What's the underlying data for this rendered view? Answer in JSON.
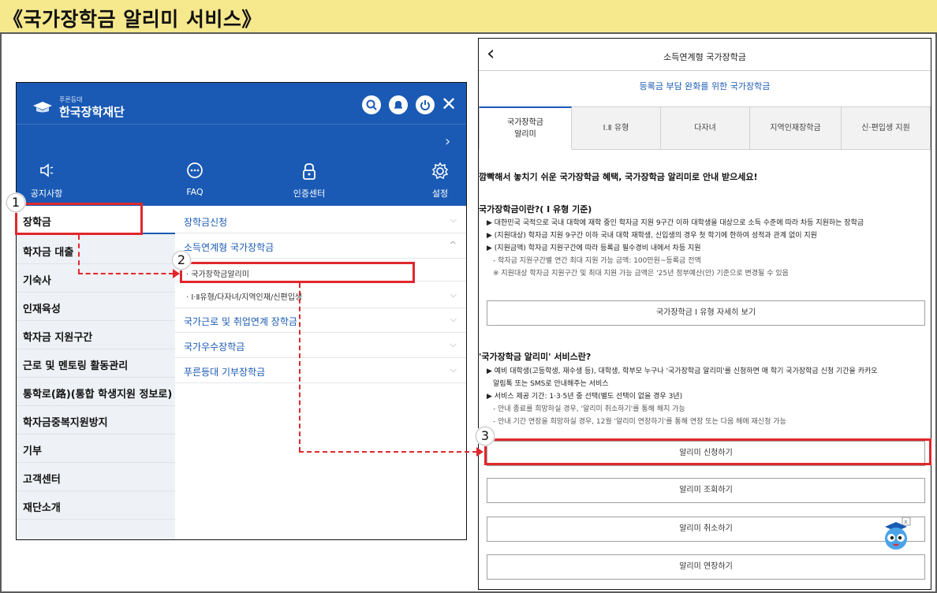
{
  "page_title": "《국가장학금 알리미 서비스》",
  "left_app": {
    "logo_sub": "푸른등대",
    "logo_name": "한국장학재단",
    "top_icons": [
      "search-icon",
      "bell-icon",
      "power-icon",
      "close-icon"
    ],
    "quick_menu": [
      {
        "label": "공지사항",
        "icon": "speaker-icon"
      },
      {
        "label": "FAQ",
        "icon": "chat-icon"
      },
      {
        "label": "인증센터",
        "icon": "lock-icon"
      },
      {
        "label": "설정",
        "icon": "gear-icon"
      }
    ],
    "menu": [
      "장학금",
      "학자금 대출",
      "기숙사",
      "인재육성",
      "학자금 지원구간",
      "근로 및 멘토링 활동관리",
      "통학로(路)(통합 학생지원 정보로)",
      "학자금중복지원방지",
      "기부",
      "고객센터",
      "재단소개"
    ],
    "submenu": [
      {
        "label": "장학금신청",
        "child": false
      },
      {
        "label": "소득연계형 국가장학금",
        "child": false
      },
      {
        "label": "· 국가장학금알리미",
        "child": true
      },
      {
        "label": "· Ⅰ·Ⅱ유형/다자녀/지역인재/신편입생",
        "child": true
      },
      {
        "label": "국가근로 및 취업연계 장학금",
        "child": false
      },
      {
        "label": "국가우수장학금",
        "child": false
      },
      {
        "label": "푸른등대 기부장학금",
        "child": false
      }
    ]
  },
  "right_app": {
    "header_title": "소득연계형 국가장학금",
    "sub_title": "등록금 부담 완화를 위한 국가장학금",
    "tabs": [
      "국가장학금\n알리미",
      "Ⅰ.Ⅱ 유형",
      "다자녀",
      "지역인재장학금",
      "신·편입생 지원"
    ],
    "lead": "깜빡해서 놓치기 쉬운 국가장학금 혜택, 국가장학금 알리미로 안내 받으세요!",
    "section1_title": "국가장학금이란?( Ⅰ 유형 기준)",
    "section1_lines": [
      "▶ 대한민국 국적으로 국내 대학에 재학 중인 학자금 지원 9구간 이하 대학생을 대상으로 소득 수준에 따라 차등 지원하는 장학금",
      "▶ (지원대상) 학자금 지원 9구간 이하 국내 대학 재학생, 신입생의 경우 첫 학기에 한하여 성적과 관계 없이 지원",
      "▶ (지원금액) 학자금 지원구간에 따라 등록금 필수경비 내에서 차등 지원",
      "-  학자금 지원구간별 연간 최대 지원 가능 금액: 100만원~등록금 전액",
      "※ 지원대상 학자금 지원구간 및 최대 지원 가능 금액은 '25년 정부예산(안) 기준으로 변경될 수 있음"
    ],
    "detail_button": "국가장학금 Ⅰ 유형 자세히 보기",
    "section2_title": "'국가장학금 알리미' 서비스란?",
    "section2_lines": [
      "▶ 예비 대학생(고등학생, 재수생 등), 대학생, 학부모 누구나 '국가장학금 알리미'를 신청하면 매 학기 국가장학금 신청 기간을 카카오",
      "알림톡 또는 SMS로 안내해주는 서비스",
      "▶ 서비스 제공 기간: 1·3·5년 중 선택(별도 선택이 없을 경우 3년)",
      "-  안내 종료를 희망하실 경우, '알리미 취소하기'를 통해 해지 가능",
      "-  안내 기간 연장을 희망하실 경우, 12월 '알리미 연장하기'를 통해 연장 또는 다음 해에 재신청 가능"
    ],
    "buttons": [
      "알리미 신청하기",
      "알리미 조회하기",
      "알리미 취소하기",
      "알리미 연장하기"
    ]
  },
  "step_badges": [
    "1",
    "2",
    "3"
  ],
  "colors": {
    "title_bg": "#f6e88d",
    "brand_blue": "#1a5ab4",
    "highlight_red": "#e0272d"
  }
}
